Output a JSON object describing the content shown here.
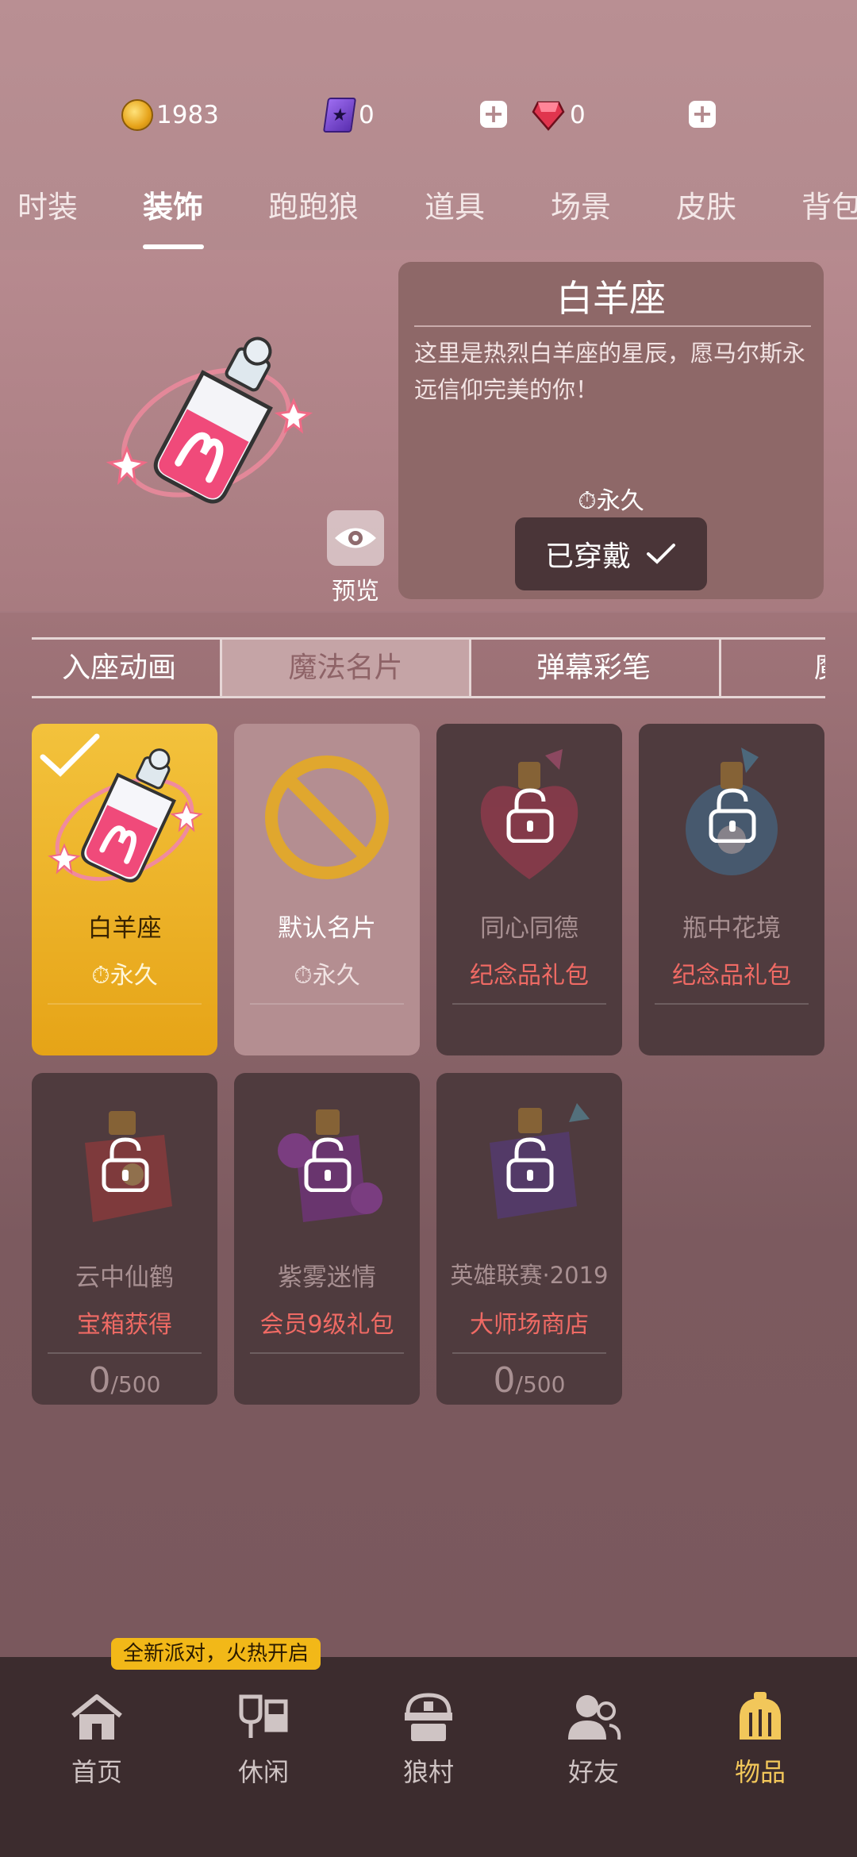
{
  "currency": {
    "coins": "1983",
    "coupons": "0",
    "gems": "0",
    "coin_icon": "gold-coin-icon",
    "coupon_icon": "purple-card-icon",
    "gem_icon": "red-gem-icon"
  },
  "category_tabs": [
    "时装",
    "装饰",
    "跑跑狼",
    "道具",
    "场景",
    "皮肤",
    "背包"
  ],
  "active_category": "装饰",
  "detail": {
    "title": "白羊座",
    "description": "这里是热烈白羊座的星辰，愿马尔斯永远信仰完美的你！",
    "duration": "永久",
    "worn_label": "已穿戴",
    "preview_label": "预览"
  },
  "sub_tabs": [
    "入座动画",
    "魔法名片",
    "弹幕彩笔",
    "魔音"
  ],
  "active_sub_tab": "魔法名片",
  "items": [
    {
      "name": "白羊座",
      "sub": "永久",
      "state": "selected"
    },
    {
      "name": "默认名片",
      "sub": "永久",
      "state": "default"
    },
    {
      "name": "同心同德",
      "sub": "纪念品礼包",
      "state": "locked"
    },
    {
      "name": "瓶中花境",
      "sub": "纪念品礼包",
      "state": "locked"
    },
    {
      "name": "云中仙鹤",
      "sub": "宝箱获得",
      "state": "locked",
      "progress": "0",
      "progress_total": "/500"
    },
    {
      "name": "紫雾迷情",
      "sub": "会员9级礼包",
      "state": "locked"
    },
    {
      "name": "英雄联赛·2019",
      "sub": "大师场商店",
      "state": "locked",
      "progress": "0",
      "progress_total": "/500"
    }
  ],
  "promo_badge": "全新派对，火热开启",
  "nav": [
    {
      "label": "首页",
      "icon": "home-icon"
    },
    {
      "label": "休闲",
      "icon": "drinks-icon"
    },
    {
      "label": "狼村",
      "icon": "village-icon"
    },
    {
      "label": "好友",
      "icon": "friends-icon"
    },
    {
      "label": "物品",
      "icon": "items-icon"
    }
  ],
  "active_nav": "物品",
  "colors": {
    "accent": "#f2c75a",
    "lock_source": "#ef6a64",
    "selected_card": "#f3c23c"
  }
}
